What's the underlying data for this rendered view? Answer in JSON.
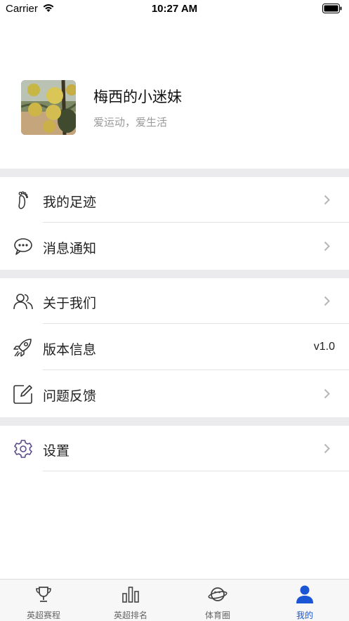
{
  "status_bar": {
    "carrier": "Carrier",
    "time": "10:27 AM"
  },
  "profile": {
    "username": "梅西的小迷妹",
    "motto": "爱运动，爱生活"
  },
  "menu": {
    "footprints": {
      "label": "我的足迹",
      "icon": "footprint-icon"
    },
    "notifications": {
      "label": "消息通知",
      "icon": "chat-bubble-icon"
    },
    "about": {
      "label": "关于我们",
      "icon": "users-icon"
    },
    "version": {
      "label": "版本信息",
      "icon": "rocket-icon",
      "value": "v1.0"
    },
    "feedback": {
      "label": "问题反馈",
      "icon": "edit-icon"
    },
    "settings": {
      "label": "设置",
      "icon": "gear-icon"
    }
  },
  "tabbar": {
    "tabs": [
      {
        "label": "英超赛程",
        "icon": "trophy-icon"
      },
      {
        "label": "英超排名",
        "icon": "bar-chart-icon"
      },
      {
        "label": "体育圈",
        "icon": "planet-icon"
      },
      {
        "label": "我的",
        "icon": "user-icon",
        "active": true
      }
    ],
    "active_color": "#1a55d6"
  }
}
